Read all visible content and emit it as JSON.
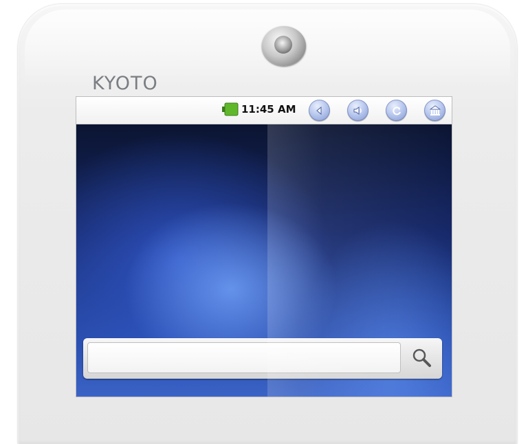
{
  "device": {
    "brand": "KYOTO"
  },
  "status_bar": {
    "time": "11:45 AM",
    "battery_icon": "battery-icon",
    "buttons": [
      {
        "name": "back-icon"
      },
      {
        "name": "volume-icon"
      },
      {
        "name": "refresh-icon"
      },
      {
        "name": "home-icon"
      }
    ]
  },
  "search": {
    "value": "",
    "placeholder": "",
    "icon": "search-icon"
  },
  "colors": {
    "battery_green": "#5fb82a",
    "button_blue": "#8ba0d8",
    "brand_gray": "#7a7d82"
  }
}
